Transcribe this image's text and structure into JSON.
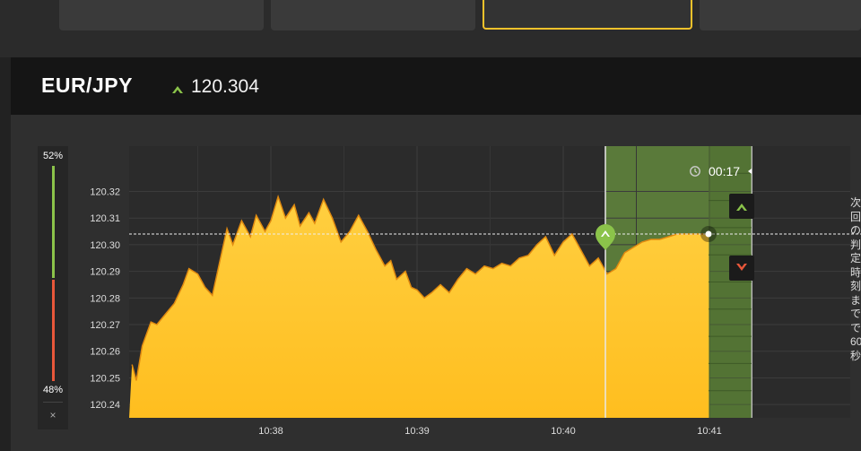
{
  "header": {
    "pair": "EUR/JPY",
    "price": "120.304"
  },
  "sentiment": {
    "up_percent": "52%",
    "down_percent": "48%",
    "up": 0.52,
    "close_label": "×"
  },
  "timer": {
    "remaining": "00:17"
  },
  "side_hint": "次回の判定時刻までで60秒",
  "colors": {
    "accent": "#f5c22b",
    "area": "#ffc933",
    "up": "#8bc34a",
    "down": "#e8573a",
    "expiry_zone": "#5a7a3a"
  },
  "chart_data": {
    "type": "area",
    "title": "",
    "xlabel": "",
    "ylabel": "",
    "ylim": [
      120.235,
      120.337
    ],
    "yticks": [
      120.24,
      120.25,
      120.26,
      120.27,
      120.28,
      120.29,
      120.3,
      120.31,
      120.32
    ],
    "xticks": [
      "10:38",
      "10:39",
      "10:40",
      "10:41"
    ],
    "x_minutes": [
      -0.95,
      -0.92,
      -0.88,
      -0.82,
      -0.78,
      -0.72,
      -0.66,
      -0.6,
      -0.56,
      -0.5,
      -0.45,
      -0.4,
      -0.36,
      -0.3,
      -0.26,
      -0.2,
      -0.14,
      -0.1,
      -0.04,
      0.0,
      0.05,
      0.1,
      0.16,
      0.2,
      0.26,
      0.3,
      0.36,
      0.42,
      0.48,
      0.54,
      0.6,
      0.66,
      0.72,
      0.78,
      0.82,
      0.86,
      0.92,
      0.96,
      1.0,
      1.05,
      1.1,
      1.16,
      1.22,
      1.28,
      1.34,
      1.4,
      1.46,
      1.52,
      1.58,
      1.64,
      1.7,
      1.76,
      1.82,
      1.88,
      1.94,
      2.0,
      2.06,
      2.12,
      2.18,
      2.24,
      2.3,
      2.36,
      2.42,
      2.48,
      2.54,
      2.6,
      2.66,
      2.72,
      2.78,
      2.84,
      2.9,
      2.96,
      3.0
    ],
    "values": [
      120.255,
      120.249,
      120.262,
      120.271,
      120.27,
      120.274,
      120.278,
      120.285,
      120.291,
      120.289,
      120.284,
      120.281,
      120.291,
      120.306,
      120.3,
      120.309,
      120.303,
      120.311,
      120.305,
      120.309,
      120.318,
      120.31,
      120.315,
      120.307,
      120.312,
      120.308,
      120.317,
      120.31,
      120.301,
      120.305,
      120.311,
      120.305,
      120.298,
      120.292,
      120.294,
      120.287,
      120.29,
      120.284,
      120.283,
      120.28,
      120.282,
      120.285,
      120.282,
      120.287,
      120.291,
      120.289,
      120.292,
      120.291,
      120.293,
      120.292,
      120.295,
      120.296,
      120.3,
      120.303,
      120.296,
      120.301,
      120.304,
      120.298,
      120.292,
      120.295,
      120.289,
      120.291,
      120.297,
      120.299,
      120.301,
      120.302,
      120.302,
      120.303,
      120.304,
      120.304,
      120.304,
      120.304,
      120.304
    ],
    "current_price": 120.304,
    "entry_minute": 1.29,
    "expiry_minute": 1.29,
    "expiry_end_minute": 1.3,
    "grid": true
  }
}
